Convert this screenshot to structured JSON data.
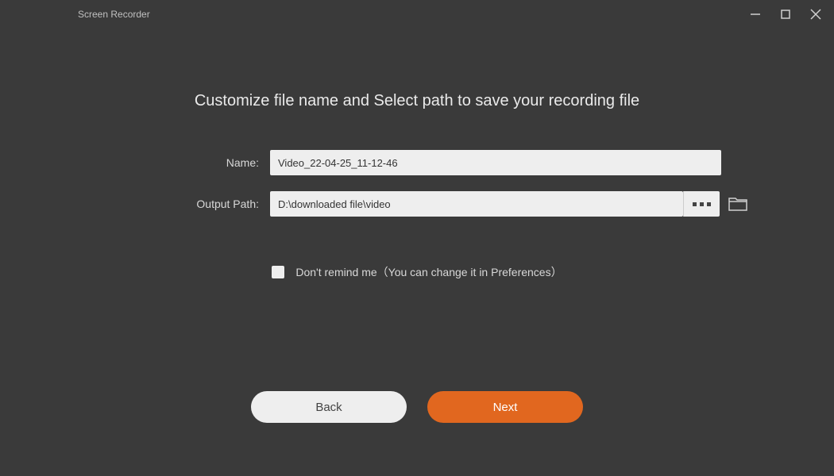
{
  "window": {
    "title": "Screen Recorder"
  },
  "dialog": {
    "heading": "Customize file name and Select path to save your recording file",
    "name_label": "Name:",
    "name_value": "Video_22-04-25_11-12-46",
    "path_label": "Output Path:",
    "path_value": "D:\\downloaded file\\video",
    "checkbox_label": "Don't remind me（You can change it in Preferences）",
    "back_button": "Back",
    "next_button": "Next"
  }
}
